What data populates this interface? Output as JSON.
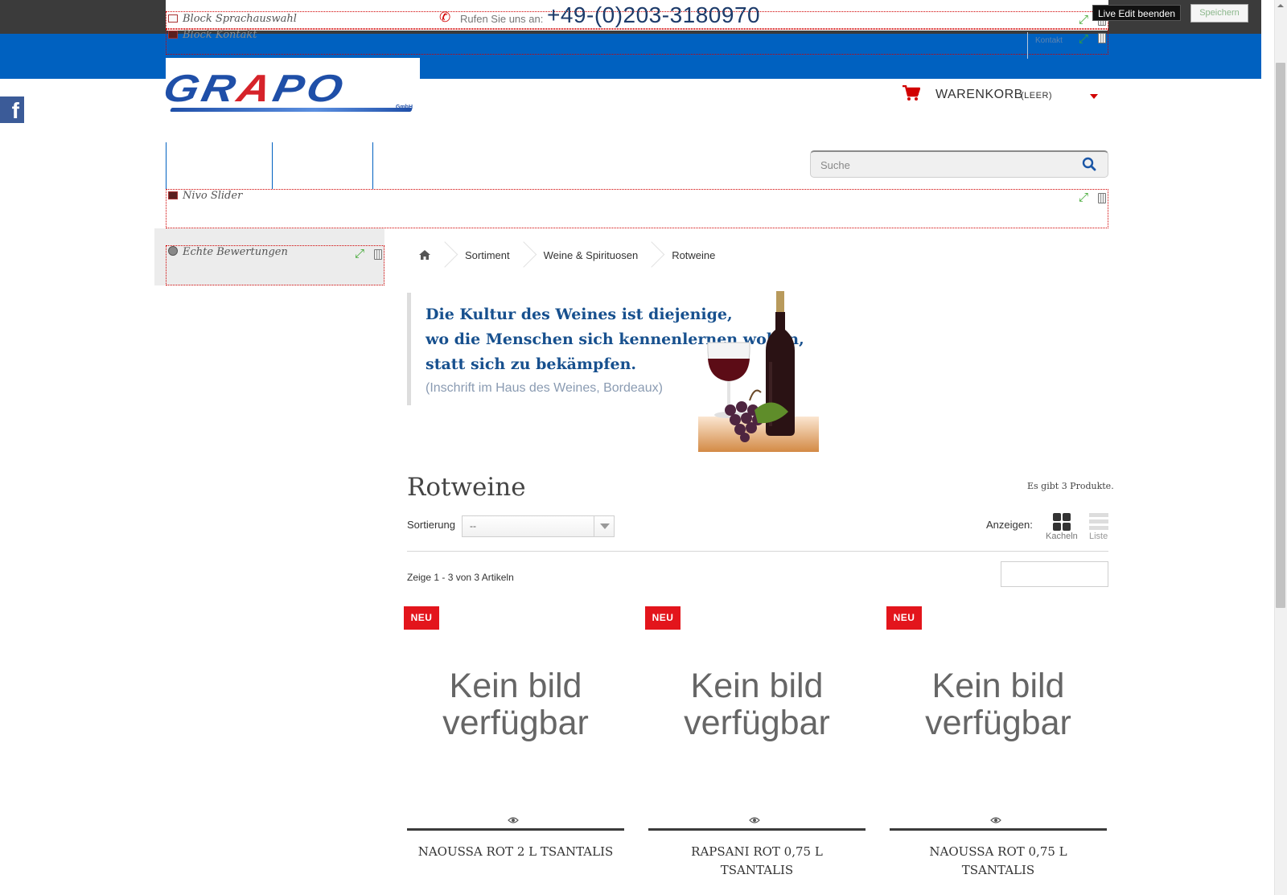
{
  "header": {
    "lang_block_label": "Block Sprachauswahl",
    "contact_block_label": "Block Kontakt",
    "phone_label": "Rufen Sie uns an:",
    "phone_number": "+49-(0)203-3180970",
    "kontakt_link": "Kontakt"
  },
  "live_edit": {
    "end_label": "Live Edit beenden",
    "save_label": "Speichern"
  },
  "logo": {
    "text_part1": "GR",
    "text_part2": "A",
    "text_part3": "PO",
    "suffix": "GmbH"
  },
  "cart": {
    "label": "WARENKORB",
    "status": "(LEER)"
  },
  "search": {
    "placeholder": "Suche"
  },
  "modules": {
    "nivo_slider": "Nivo Slider",
    "reviews": "Echte Bewertungen"
  },
  "breadcrumb": [
    "Sortiment",
    "Weine & Spirituosen",
    "Rotweine"
  ],
  "quote": {
    "lines": [
      "Die Kultur des Weines ist diejenige,",
      "wo die Menschen sich kennenlernen wollen,",
      "statt sich zu bekämpfen."
    ],
    "source": "(Inschrift im Haus des Weines, Bordeaux)"
  },
  "category": {
    "title": "Rotweine",
    "product_count": "Es gibt 3 Produkte.",
    "sort_label": "Sortierung",
    "sort_value": "--",
    "view_label": "Anzeigen:",
    "grid_label": "Kacheln",
    "list_label": "Liste",
    "showing": "Zeige 1 - 3 von 3 Artikeln"
  },
  "products": [
    {
      "badge": "NEU",
      "no_image_1": "Kein bild",
      "no_image_2": "verfügbar",
      "name_1": "NAOUSSA ROT 2 L TSANTALIS",
      "name_2": ""
    },
    {
      "badge": "NEU",
      "no_image_1": "Kein bild",
      "no_image_2": "verfügbar",
      "name_1": "RAPSANI ROT 0,75 L",
      "name_2": "TSANTALIS"
    },
    {
      "badge": "NEU",
      "no_image_1": "Kein bild",
      "no_image_2": "verfügbar",
      "name_1": "NAOUSSA ROT 0,75 L",
      "name_2": "TSANTALIS"
    }
  ],
  "colors": {
    "brand_blue": "#0061c0",
    "accent_red": "#e3151c",
    "quote_blue": "#17508e"
  }
}
